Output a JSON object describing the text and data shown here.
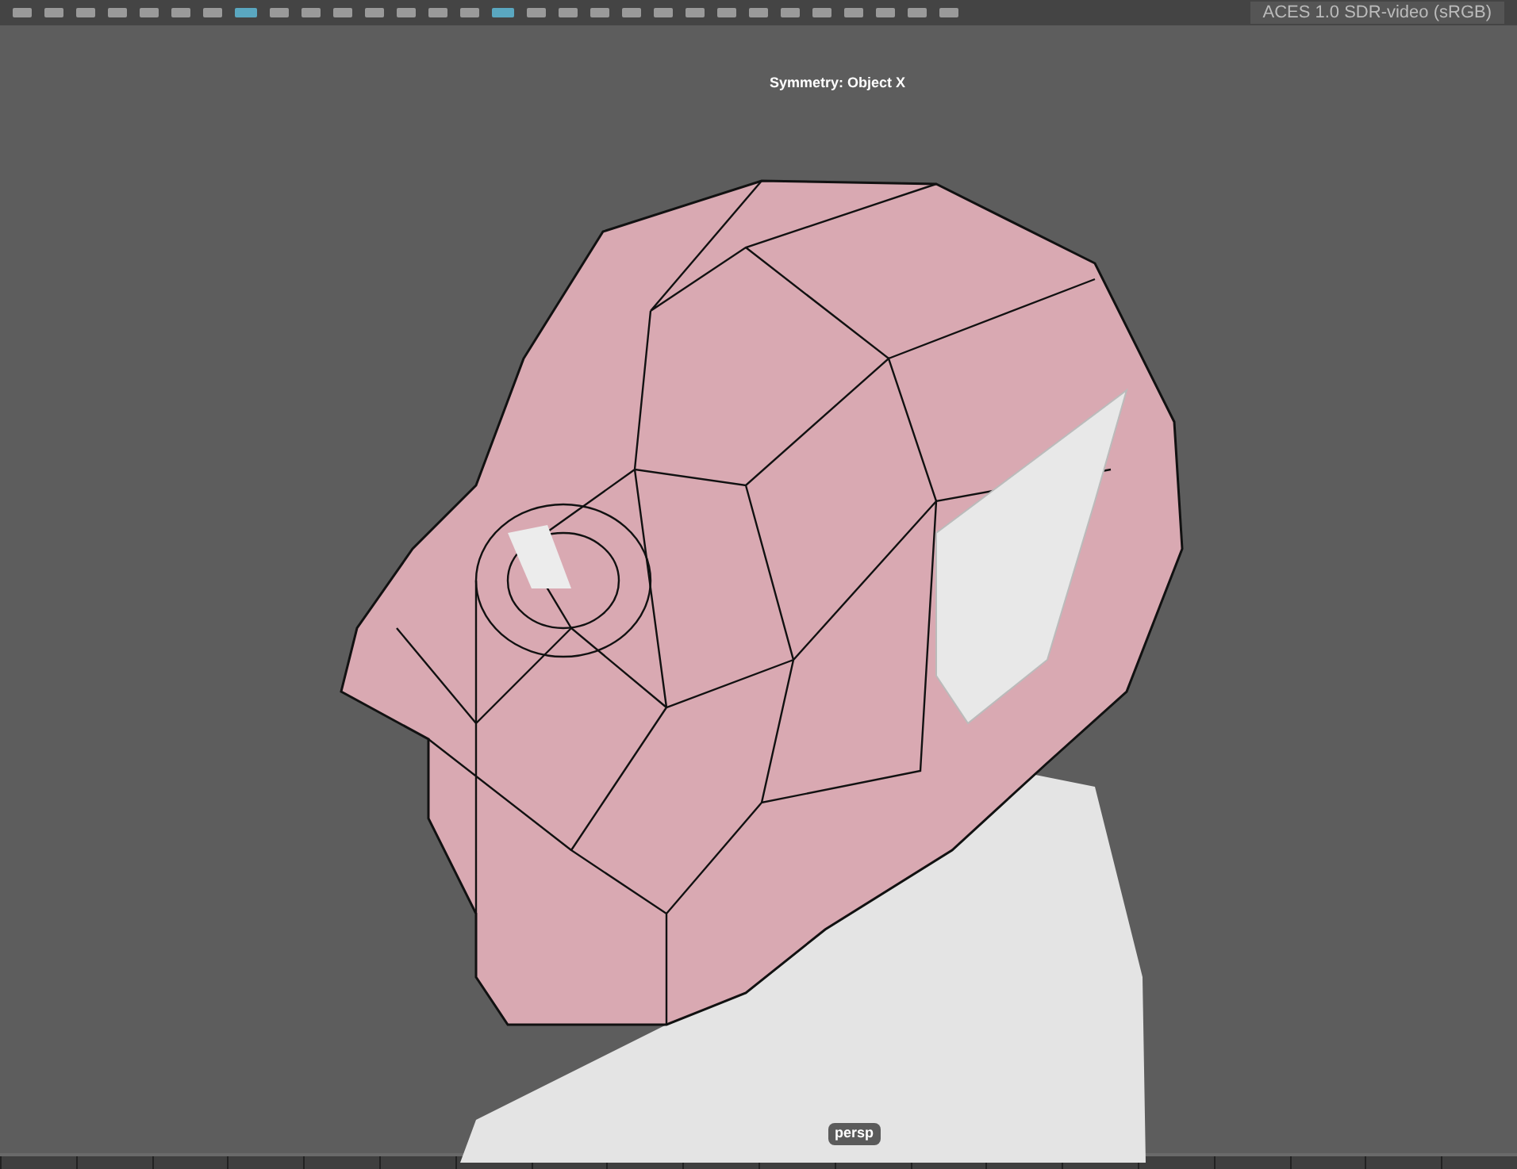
{
  "toolbar": {
    "buttons": [
      {
        "selected": false
      },
      {
        "selected": false
      },
      {
        "selected": false
      },
      {
        "selected": false
      },
      {
        "selected": false
      },
      {
        "selected": false
      },
      {
        "selected": false
      },
      {
        "selected": true
      },
      {
        "selected": false
      },
      {
        "selected": false
      },
      {
        "selected": false
      },
      {
        "selected": false
      },
      {
        "selected": false
      },
      {
        "selected": false
      },
      {
        "selected": false
      },
      {
        "selected": true
      },
      {
        "selected": false
      },
      {
        "selected": false
      },
      {
        "selected": false
      },
      {
        "selected": false
      },
      {
        "selected": false
      },
      {
        "selected": false
      },
      {
        "selected": false
      },
      {
        "selected": false
      },
      {
        "selected": false
      },
      {
        "selected": false
      },
      {
        "selected": false
      },
      {
        "selected": false
      },
      {
        "selected": false
      },
      {
        "selected": false
      }
    ],
    "color_space": "ACES 1.0 SDR-video (sRGB)"
  },
  "viewport": {
    "heading": "Symmetry: Object X",
    "camera": "persp"
  }
}
